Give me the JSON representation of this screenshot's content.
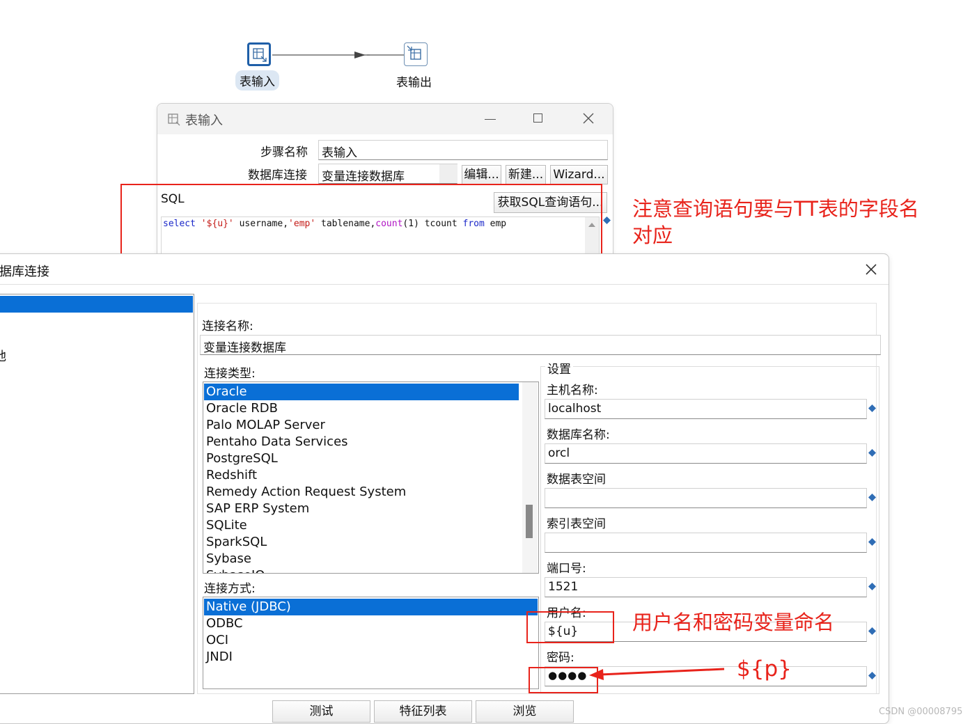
{
  "canvas": {
    "step_input_label": "表输入",
    "step_output_label": "表输出"
  },
  "dialog_table_input": {
    "title": "表输入",
    "step_name_label": "步骤名称",
    "step_name_value": "表输入",
    "db_conn_label": "数据库连接",
    "db_conn_value": "变量连接数据库",
    "edit_button": "编辑...",
    "new_button": "新建...",
    "wizard_button": "Wizard...",
    "sql_label": "SQL",
    "get_sql_button": "获取SQL查询语句...",
    "sql_tokens": {
      "t1": "select",
      "t2": " ",
      "t3": "'${u}'",
      "t4": " username,",
      "t5": "'emp'",
      "t6": " tablename,",
      "t7": "count",
      "t8": "(1) tcount ",
      "t9": "from",
      "t10": " emp"
    }
  },
  "dialog_db_connection": {
    "title": "数据库连接",
    "left_item_partial": "地",
    "connection_name_label": "连接名称:",
    "connection_name_value": "变量连接数据库",
    "connection_type_label": "连接类型:",
    "connection_types": [
      "Oracle",
      "Oracle RDB",
      "Palo MOLAP Server",
      "Pentaho Data Services",
      "PostgreSQL",
      "Redshift",
      "Remedy Action Request System",
      "SAP ERP System",
      "SQLite",
      "SparkSQL",
      "Sybase",
      "SybaseIQ"
    ],
    "connection_type_selected": "Oracle",
    "access_label": "连接方式:",
    "access_methods": [
      "Native (JDBC)",
      "ODBC",
      "OCI",
      "JNDI"
    ],
    "access_selected": "Native (JDBC)",
    "settings_legend": "设置",
    "host_label": "主机名称:",
    "host_value": "localhost",
    "dbname_label": "数据库名称:",
    "dbname_value": "orcl",
    "data_tablespace_label": "数据表空间",
    "data_tablespace_value": "",
    "index_tablespace_label": "索引表空间",
    "index_tablespace_value": "",
    "port_label": "端口号:",
    "port_value": "1521",
    "username_label": "用户名:",
    "username_value": "${u}",
    "password_label": "密码:",
    "password_value": "●●●●",
    "test_button": "测试",
    "features_button": "特征列表",
    "browse_button": "浏览"
  },
  "annotations": {
    "note_sql": "注意查询语句要与TT表的字段名对应",
    "note_vars": "用户名和密码变量命名",
    "note_password": "${p}",
    "color": "#e8231b"
  },
  "watermark": "CSDN @00008795"
}
